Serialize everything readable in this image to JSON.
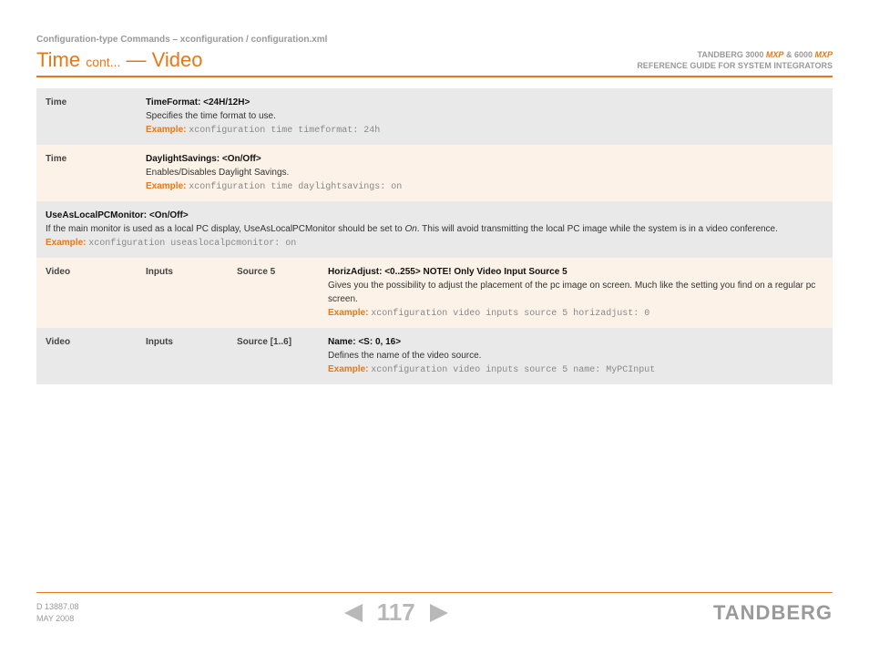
{
  "breadcrumb": "Configuration-type Commands – xconfiguration / configuration.xml",
  "title_main": "Time",
  "title_cont": "cont...",
  "title_sep": "—",
  "title_section": "Video",
  "doc_meta_line1a": "TANDBERG 3000",
  "doc_meta_mxp": "MXP",
  "doc_meta_amp": " & 6000",
  "doc_meta_line2": "REFERENCE GUIDE FOR SYSTEM INTEGRATORS",
  "rows": {
    "r1_col1": "Time",
    "r1_param": "TimeFormat: <24H/12H>",
    "r1_desc": "Specifies the time format to use.",
    "r1_ex_label": "Example:",
    "r1_ex_code": "xconfiguration time timeformat: 24h",
    "r2_col1": "Time",
    "r2_param": "DaylightSavings: <On/Off>",
    "r2_desc": "Enables/Disables Daylight Savings.",
    "r2_ex_label": "Example:",
    "r2_ex_code": "xconfiguration time daylightsavings: on",
    "r3_param": "UseAsLocalPCMonitor: <On/Off>",
    "r3_desc_a": "If the main monitor is used as a local PC display, UseAsLocalPCMonitor should be set to ",
    "r3_desc_i": "On",
    "r3_desc_b": ". This will avoid transmitting the local PC image while the system is in a video conference.",
    "r3_ex_label": "Example:",
    "r3_ex_code": "xconfiguration useaslocalpcmonitor: on",
    "r4_col1": "Video",
    "r4_col2": "Inputs",
    "r4_col3": "Source 5",
    "r4_param": "HorizAdjust: <0..255> NOTE! Only Video Input Source 5",
    "r4_desc": "Gives you the possibility to adjust the placement of the pc image on screen. Much like the setting you find on a regular pc screen.",
    "r4_ex_label": "Example:",
    "r4_ex_code": "xconfiguration video inputs source 5 horizadjust: 0",
    "r5_col1": "Video",
    "r5_col2": "Inputs",
    "r5_col3": "Source [1..6]",
    "r5_param": "Name: <S: 0, 16>",
    "r5_desc": "Defines the name of the video source.",
    "r5_ex_label": "Example:",
    "r5_ex_code": "xconfiguration video inputs source 5 name: MyPCInput"
  },
  "footer": {
    "doc_id": "D 13887.08",
    "date": "MAY 2008",
    "page": "117",
    "brand": "TANDBERG"
  }
}
